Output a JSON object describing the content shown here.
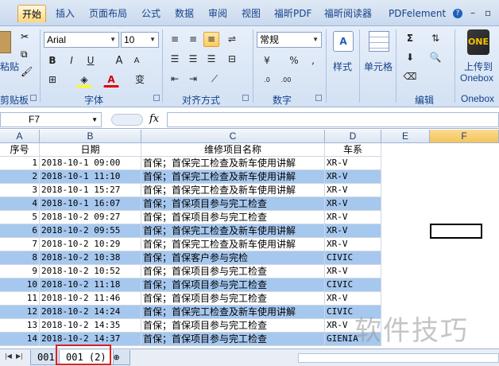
{
  "ribbon_tabs": [
    "开始",
    "插入",
    "页面布局",
    "公式",
    "数据",
    "审阅",
    "视图",
    "福昕PDF",
    "福昕阅读器",
    "PDFelement"
  ],
  "help_icon": "?",
  "clipboard": {
    "paste_label": "粘贴",
    "group_label": "剪贴板"
  },
  "font": {
    "name": "Arial",
    "size": "10",
    "bold": "B",
    "italic": "I",
    "underline": "U",
    "grow": "A",
    "shrink": "A",
    "phonetic": "变",
    "group_label": "字体"
  },
  "alignment": {
    "group_label": "对齐方式"
  },
  "number": {
    "format": "常规",
    "percent": "%",
    "comma": ",",
    "inc_decimal": ".0→.00",
    "dec_decimal": ".00→.0",
    "group_label": "数字"
  },
  "styles": {
    "label": "样式"
  },
  "cells": {
    "label": "单元格"
  },
  "editing": {
    "sum": "Σ",
    "group_label": "编辑"
  },
  "onebox": {
    "upload_label": "上传到",
    "upload_sub": "Onebox",
    "group_label": "Onebox"
  },
  "namebox": "F7",
  "fx": "fx",
  "columns": [
    "A",
    "B",
    "C",
    "D",
    "E",
    "F"
  ],
  "header_row": {
    "a": "序号",
    "b": "日期",
    "c": "维修项目名称",
    "d": "车系"
  },
  "rows": [
    {
      "num": "1",
      "date": "2018-10-1 09:00",
      "item": "首保；首保完工检查及新车使用讲解",
      "model": "XR-V"
    },
    {
      "num": "2",
      "date": "2018-10-1 11:10",
      "item": "首保；首保完工检查及新车使用讲解",
      "model": "XR-V"
    },
    {
      "num": "3",
      "date": "2018-10-1 15:27",
      "item": "首保；首保完工检查及新车使用讲解",
      "model": "XR-V"
    },
    {
      "num": "4",
      "date": "2018-10-1 16:07",
      "item": "首保；首保项目参与完工检查",
      "model": "XR-V"
    },
    {
      "num": "5",
      "date": "2018-10-2 09:27",
      "item": "首保；首保项目参与完工检查",
      "model": "XR-V"
    },
    {
      "num": "6",
      "date": "2018-10-2 09:55",
      "item": "首保；首保完工检查及新车使用讲解",
      "model": "XR-V"
    },
    {
      "num": "7",
      "date": "2018-10-2 10:29",
      "item": "首保；首保完工检查及新车使用讲解",
      "model": "XR-V"
    },
    {
      "num": "8",
      "date": "2018-10-2 10:38",
      "item": "首保；首保客户参与完检",
      "model": "CIVIC"
    },
    {
      "num": "9",
      "date": "2018-10-2 10:52",
      "item": "首保；首保项目参与完工检查",
      "model": "XR-V"
    },
    {
      "num": "10",
      "date": "2018-10-2 11:18",
      "item": "首保；首保项目参与完工检查",
      "model": "CIVIC"
    },
    {
      "num": "11",
      "date": "2018-10-2 11:46",
      "item": "首保；首保项目参与完工检查",
      "model": "XR-V"
    },
    {
      "num": "12",
      "date": "2018-10-2 14:24",
      "item": "首保；首保完工检查及新车使用讲解",
      "model": "CIVIC"
    },
    {
      "num": "13",
      "date": "2018-10-2 14:35",
      "item": "首保；首保项目参与完工检查",
      "model": "XR-V"
    },
    {
      "num": "14",
      "date": "2018-10-2 14:37",
      "item": "首保；首保项目参与完工检查",
      "model": "GIENIA"
    }
  ],
  "sheet_tabs": [
    "001",
    "001 (2)"
  ],
  "watermark": "软件技巧",
  "colors": {
    "accent": "#15428b",
    "highlight_row": "#a6c8ef",
    "red_box": "#e02020"
  }
}
